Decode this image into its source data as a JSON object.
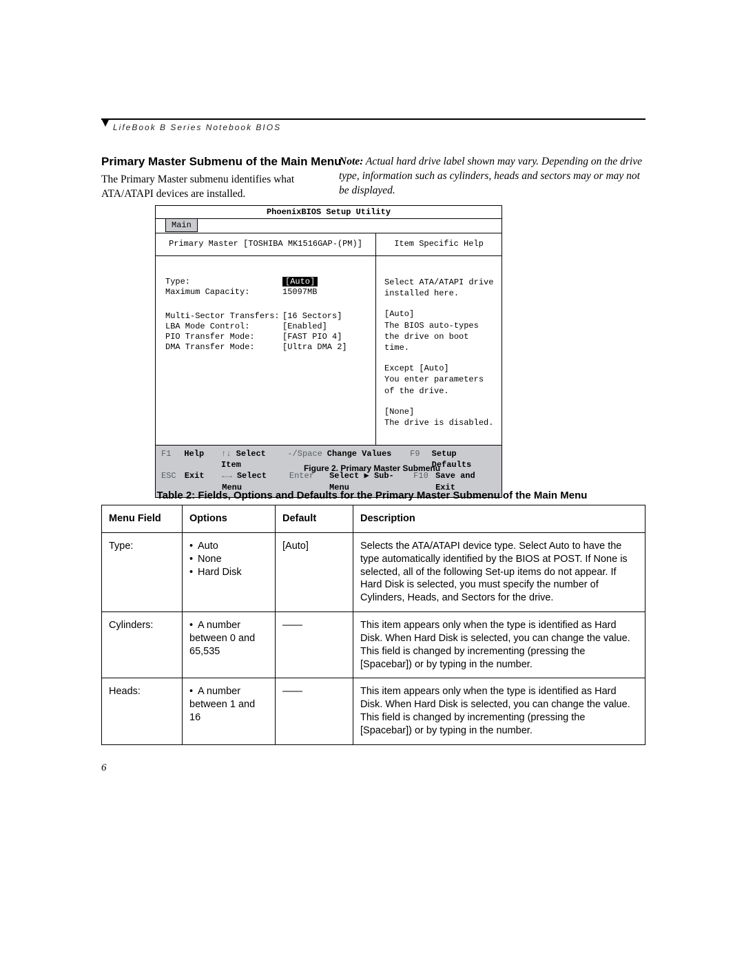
{
  "header": "LifeBook B Series Notebook BIOS",
  "section_title": "Primary Master Submenu of the Main Menu",
  "intro_left": "The Primary Master submenu identifies what ATA/ATAPI devices are installed.",
  "intro_right_label": "Note:",
  "intro_right": " Actual hard drive label shown may vary. Depending on the drive type, information such as cylinders, heads and sectors may or may not be displayed.",
  "bios": {
    "title": "PhoenixBIOS Setup Utility",
    "tab": "Main",
    "left_header": "Primary Master [TOSHIBA MK1516GAP-(PM)]",
    "fields": [
      {
        "label": "Type:",
        "value": "[Auto]",
        "selected": true
      },
      {
        "label": "Maximum Capacity:",
        "value": "15097MB"
      }
    ],
    "fields2": [
      {
        "label": "Multi-Sector Transfers:",
        "value": "[16 Sectors]"
      },
      {
        "label": "LBA Mode Control:",
        "value": "[Enabled]"
      },
      {
        "label": "PIO Transfer Mode:",
        "value": "[FAST PIO 4]"
      },
      {
        "label": "DMA Transfer Mode:",
        "value": "[Ultra DMA 2]"
      }
    ],
    "right_header": "Item Specific Help",
    "help": [
      "Select ATA/ATAPI drive installed here.",
      "[Auto]\nThe BIOS auto-types the drive on boot time.",
      "Except [Auto]\nYou enter parameters of the drive.",
      "[None]\nThe drive is disabled."
    ],
    "footer": {
      "r1": {
        "k1": "F1",
        "k2": "Help",
        "k3a": "↑↓",
        "k3b": " Select Item",
        "k4": "-/Space",
        "k5": "Change Values",
        "k6": "F9",
        "k7": "Setup Defaults"
      },
      "r2": {
        "k1": "ESC",
        "k2": "Exit",
        "k3a": "←→",
        "k3b": " Select Menu",
        "k4": "Enter",
        "k5": "Select ▶ Sub-Menu",
        "k6": "F10",
        "k7": "Save and Exit"
      }
    }
  },
  "figure_caption": "Figure 2.  Primary Master Submenu",
  "table_caption": "Table 2: Fields, Options and Defaults for the Primary Master Submenu of the Main Menu",
  "table": {
    "headers": {
      "field": "Menu Field",
      "options": "Options",
      "default": "Default",
      "desc": "Description"
    },
    "rows": [
      {
        "field": "Type:",
        "options": [
          "Auto",
          "None",
          "Hard Disk"
        ],
        "default": "[Auto]",
        "desc": "Selects the ATA/ATAPI device type. Select Auto to have the type automatically identified by the BIOS at POST. If None is selected, all of the following Set-up items do not appear. If Hard Disk is selected, you must specify the number of Cylinders, Heads, and Sectors for the drive."
      },
      {
        "field": "Cylinders:",
        "options": [
          "A number between 0 and 65,535"
        ],
        "default": "——",
        "desc": "This item appears only when the type is identified as Hard Disk. When Hard Disk is selected, you can change the value. This field is changed by incrementing (pressing the [Spacebar]) or by typing in the number."
      },
      {
        "field": "Heads:",
        "options": [
          "A number between 1 and 16"
        ],
        "default": "——",
        "desc": "This item appears only when the type is identified as Hard Disk. When Hard Disk is selected, you can change the value. This field is changed by incrementing (pressing the [Spacebar]) or by typing in the number."
      }
    ]
  },
  "page_number": "6"
}
